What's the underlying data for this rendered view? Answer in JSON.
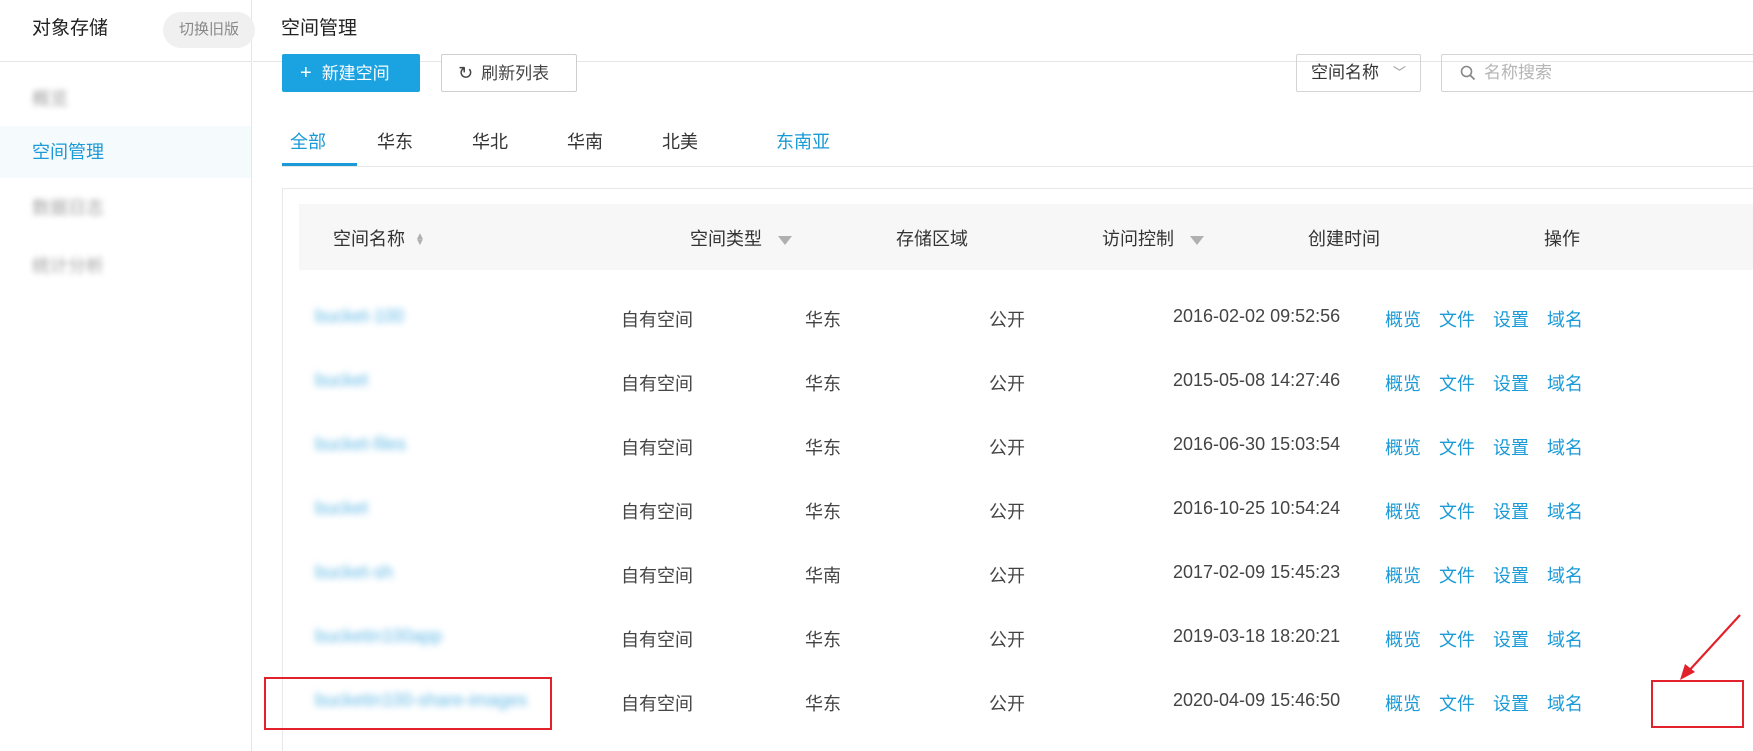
{
  "sidebar": {
    "title": "对象存储",
    "switch_label": "切换旧版",
    "items": [
      {
        "label": "概览",
        "blurred": true
      },
      {
        "label": "空间管理",
        "active": true
      },
      {
        "label": "数据日志",
        "blurred": true
      },
      {
        "label": "统计分析",
        "blurred": true
      }
    ]
  },
  "header": {
    "title": "空间管理"
  },
  "toolbar": {
    "new_label": "新建空间",
    "refresh_label": "刷新列表",
    "select_value": "空间名称",
    "search_placeholder": "名称搜索"
  },
  "tabs": [
    {
      "label": "全部",
      "active": true
    },
    {
      "label": "华东"
    },
    {
      "label": "华北"
    },
    {
      "label": "华南"
    },
    {
      "label": "北美"
    },
    {
      "label": "东南亚",
      "highlight": true
    }
  ],
  "table": {
    "columns": [
      "空间名称",
      "空间类型",
      "存储区域",
      "访问控制",
      "创建时间",
      "操作"
    ],
    "actions": [
      "概览",
      "文件",
      "设置",
      "域名"
    ],
    "rows": [
      {
        "name": "bucket-100",
        "type": "自有空间",
        "region": "华东",
        "access": "公开",
        "created": "2016-02-02 09:52:56"
      },
      {
        "name": "bucket",
        "type": "自有空间",
        "region": "华东",
        "access": "公开",
        "created": "2015-05-08 14:27:46"
      },
      {
        "name": "bucket-files",
        "type": "自有空间",
        "region": "华东",
        "access": "公开",
        "created": "2016-06-30 15:03:54"
      },
      {
        "name": "bucket",
        "type": "自有空间",
        "region": "华东",
        "access": "公开",
        "created": "2016-10-25 10:54:24"
      },
      {
        "name": "bucket-sh",
        "type": "自有空间",
        "region": "华南",
        "access": "公开",
        "created": "2017-02-09 15:45:23"
      },
      {
        "name": "bucketin100app",
        "type": "自有空间",
        "region": "华东",
        "access": "公开",
        "created": "2019-03-18 18:20:21"
      },
      {
        "name": "bucketin100-share-images",
        "type": "自有空间",
        "region": "华东",
        "access": "公开",
        "created": "2020-04-09 15:46:50"
      }
    ]
  },
  "colors": {
    "accent": "#1a9ad6",
    "primary_button": "#1aa3e0",
    "annotation": "#e2222a"
  }
}
